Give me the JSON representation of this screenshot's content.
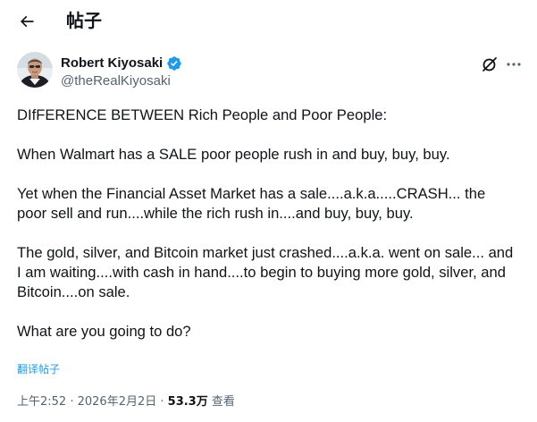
{
  "header": {
    "back_icon": "arrow-left-icon",
    "title": "帖子"
  },
  "author": {
    "name": "Robert Kiyosaki",
    "handle": "@theRealKiyosaki",
    "verified_icon": "verified-badge-icon",
    "verified_color": "#1d9bf0"
  },
  "actions": {
    "grok_icon": "grok-icon",
    "more_icon": "more-dots-icon"
  },
  "tweet": {
    "paragraphs": [
      "DIfFERENCE BETWEEN Rich People and Poor People:",
      "When Walmart has a SALE poor people rush in and buy, buy, buy.",
      "Yet when the Financial Asset Market has  a sale....a.k.a.....CRASH... the poor sell and run....while the rich rush in....and buy, buy, buy.",
      "The gold, silver, and Bitcoin market just  crashed....a.k.a. went on sale... and I am waiting....with cash in hand....to begin to buying more gold, silver, and Bitcoin....on sale.",
      "What are you going to do?"
    ],
    "translate_label": "翻译帖子"
  },
  "meta": {
    "time": "上午2:52",
    "separator": " · ",
    "date": "2026年2月2日",
    "views_count": "53.3万",
    "views_label": "查看"
  },
  "colors": {
    "text": "#0f1419",
    "secondary": "#536471",
    "accent": "#1d9bf0"
  }
}
